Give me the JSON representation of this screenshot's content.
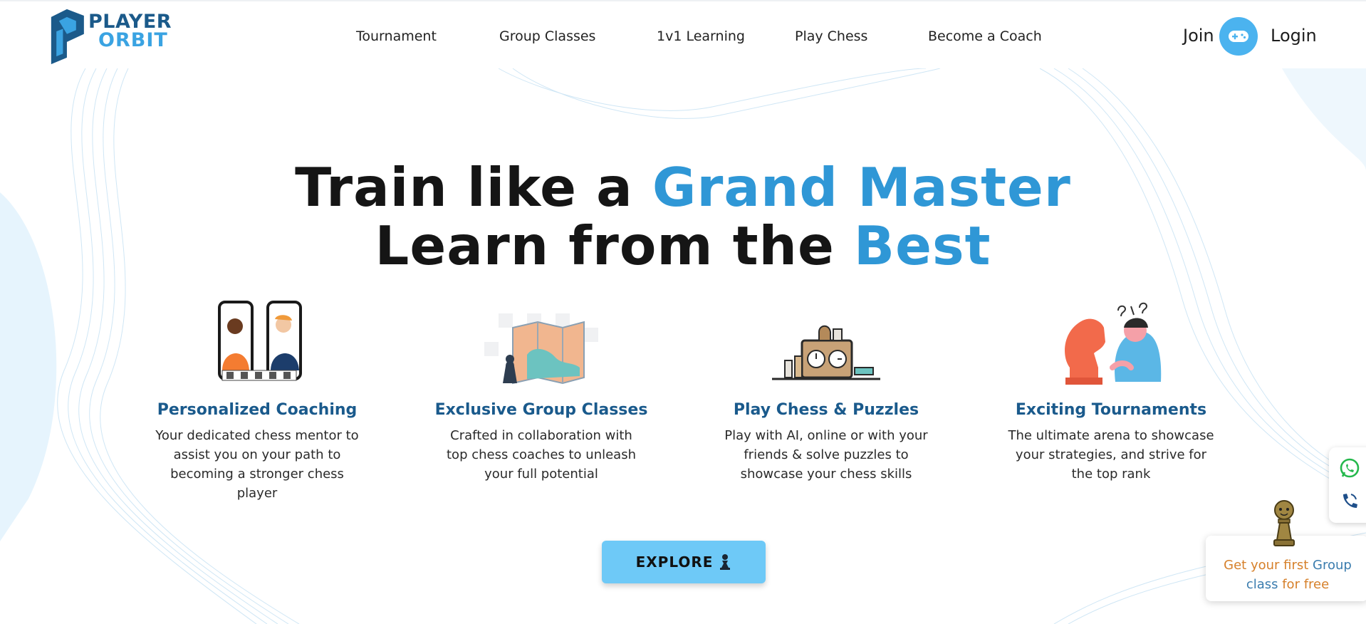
{
  "brand": {
    "line1": "PLAYER",
    "line2": "ORBIT"
  },
  "nav": {
    "links": [
      "Tournament",
      "Group Classes",
      "1v1 Learning",
      "Play Chess",
      "Become a Coach"
    ],
    "join_label": "Join",
    "join_icon": "gamepad-icon",
    "login_label": "Login"
  },
  "hero": {
    "line1_plain": "Train like a ",
    "line1_accent": "Grand Master",
    "line2_plain": "Learn from the ",
    "line2_accent": "Best"
  },
  "features": [
    {
      "icon": "online-coaching-illustration",
      "title": "Personalized Coaching",
      "desc": "Your dedicated chess mentor to assist you on your path to becoming a stronger chess player"
    },
    {
      "icon": "group-class-map-illustration",
      "title": "Exclusive Group Classes",
      "desc": "Crafted in collaboration with top chess coaches to unleash your full potential"
    },
    {
      "icon": "chess-clock-illustration",
      "title": "Play Chess & Puzzles",
      "desc": "Play with AI, online or with your friends & solve puzzles to showcase your chess skills"
    },
    {
      "icon": "tournament-knight-illustration",
      "title": "Exciting Tournaments",
      "desc": "The ultimate arena to showcase your strategies, and strive for the top rank"
    }
  ],
  "cta": {
    "label": "EXPLORE",
    "icon": "chess-pawn-icon"
  },
  "contact": {
    "whatsapp_icon": "whatsapp-icon",
    "phone_icon": "phone-icon"
  },
  "promo": {
    "text_a": "Get your first ",
    "text_b": "Group class",
    "text_c": " for free",
    "icon": "pawn-mascot-icon"
  },
  "colors": {
    "accent": "#2f97d6",
    "brand_dark": "#1b5a8a",
    "button": "#6ec9f7",
    "feature_title": "#1a5a8c"
  }
}
